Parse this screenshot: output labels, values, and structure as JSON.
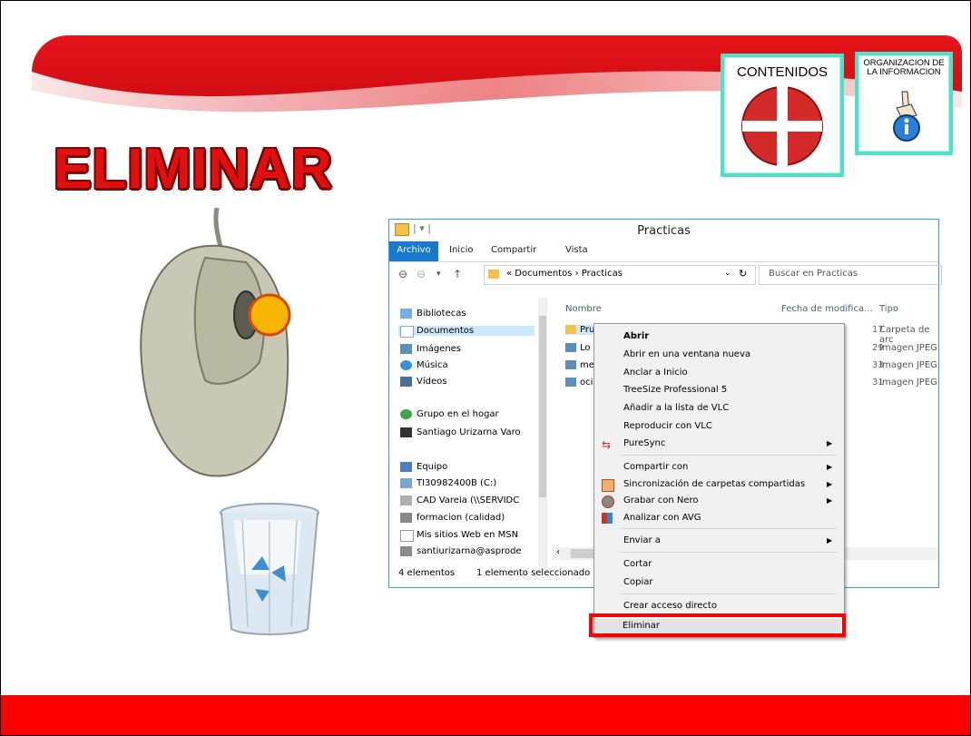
{
  "slide": {
    "title": "ELIMINAR",
    "cards": [
      {
        "label": "CONTENIDOS",
        "icon": "cross-circle-icon"
      },
      {
        "label": "ORGANIZACION DE LA INFORMACION",
        "icon": "info-hand-icon"
      }
    ]
  },
  "explorer": {
    "title": "Practicas",
    "ribbon_tabs": [
      "Archivo",
      "Inicio",
      "Compartir",
      "Vista"
    ],
    "address": "« Documentos › Practicas",
    "search_placeholder": "Buscar en Practicas",
    "columns": {
      "name": "Nombre",
      "date": "Fecha de modifica...",
      "type": "Tipo"
    },
    "nav": [
      {
        "label": "Bibliotecas"
      },
      {
        "label": "Documentos"
      },
      {
        "label": "Imágenes"
      },
      {
        "label": "Música"
      },
      {
        "label": "Vídeos"
      },
      {
        "label": "Grupo en el hogar"
      },
      {
        "label": "Santiago Urizarna Varo"
      },
      {
        "label": "Equipo"
      },
      {
        "label": "TI30982400B (C:)"
      },
      {
        "label": "CAD Vareia (\\\\SERVIDC"
      },
      {
        "label": "formacion (calidad)"
      },
      {
        "label": "Mis sitios Web en MSN"
      },
      {
        "label": "santiurizarna@asprode"
      }
    ],
    "files": [
      {
        "name": "Pru",
        "date": "17",
        "type": "Carpeta de arc"
      },
      {
        "name": "Lo",
        "date": "29",
        "type": "Imagen JPEG"
      },
      {
        "name": "me",
        "date": "33",
        "type": "Imagen JPEG"
      },
      {
        "name": "oci",
        "date": "31",
        "type": "Imagen JPEG"
      }
    ],
    "status_count": "4 elementos",
    "status_selected": "1 elemento seleccionado"
  },
  "context_menu": {
    "items": [
      "Abrir",
      "Abrir en una ventana nueva",
      "Anclar a Inicio",
      "TreeSize Professional 5",
      "Añadir a la lista de VLC",
      "Reproducir con VLC",
      "PureSync",
      "Compartir con",
      "Sincronización de carpetas compartidas",
      "Grabar con Nero",
      "Analizar con AVG",
      "Enviar a",
      "Cortar",
      "Copiar",
      "Crear acceso directo",
      "Eliminar"
    ],
    "highlight_color": "#ff0000"
  },
  "colors": {
    "banner_red": "#e01010",
    "card_border": "#4fe0c8",
    "footer": "#ff0000",
    "accent_blue": "#1979ca"
  }
}
